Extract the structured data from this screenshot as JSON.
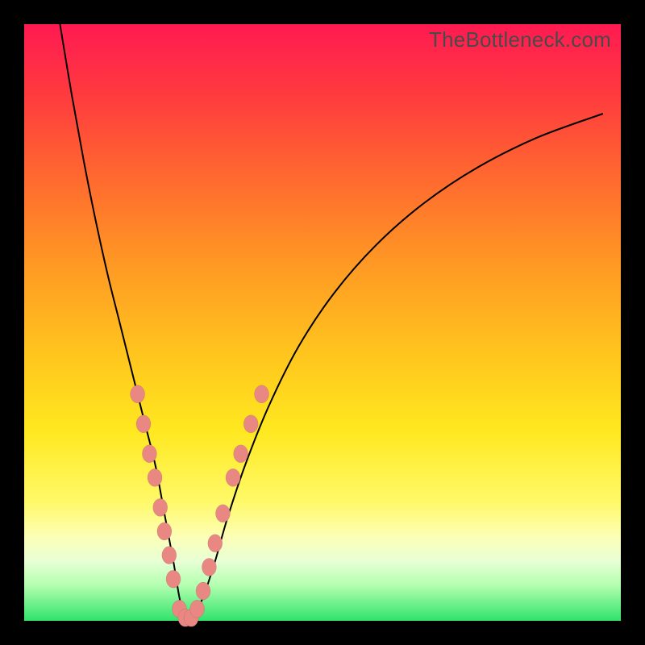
{
  "watermark": "TheBottleneck.com",
  "chart_data": {
    "type": "line",
    "title": "",
    "xlabel": "",
    "ylabel": "",
    "xlim": [
      0,
      100
    ],
    "ylim": [
      0,
      100
    ],
    "series": [
      {
        "name": "bottleneck-curve",
        "x": [
          6,
          8,
          10,
          12,
          14,
          16,
          18,
          20,
          22,
          23.5,
          25,
          26,
          27,
          28,
          30,
          32,
          34,
          37,
          41,
          46,
          52,
          59,
          67,
          76,
          86,
          97
        ],
        "y": [
          100,
          88,
          77,
          67,
          58,
          50,
          42,
          34,
          26,
          18,
          10,
          4,
          0,
          0,
          4,
          10,
          17,
          26,
          36,
          46,
          55,
          63,
          70,
          76,
          81,
          85
        ]
      }
    ],
    "markers": {
      "name": "beads",
      "points": [
        {
          "x": 19.0,
          "y": 38
        },
        {
          "x": 20.0,
          "y": 33
        },
        {
          "x": 21.0,
          "y": 28
        },
        {
          "x": 21.9,
          "y": 24
        },
        {
          "x": 22.8,
          "y": 19
        },
        {
          "x": 23.5,
          "y": 15
        },
        {
          "x": 24.3,
          "y": 11
        },
        {
          "x": 25.0,
          "y": 7
        },
        {
          "x": 26.0,
          "y": 2
        },
        {
          "x": 27.0,
          "y": 0.5
        },
        {
          "x": 28.0,
          "y": 0.5
        },
        {
          "x": 29.0,
          "y": 2
        },
        {
          "x": 30.0,
          "y": 5
        },
        {
          "x": 31.0,
          "y": 9
        },
        {
          "x": 32.0,
          "y": 13
        },
        {
          "x": 33.3,
          "y": 18
        },
        {
          "x": 35.0,
          "y": 24
        },
        {
          "x": 36.3,
          "y": 28
        },
        {
          "x": 38.0,
          "y": 33
        },
        {
          "x": 39.8,
          "y": 38
        }
      ]
    }
  }
}
